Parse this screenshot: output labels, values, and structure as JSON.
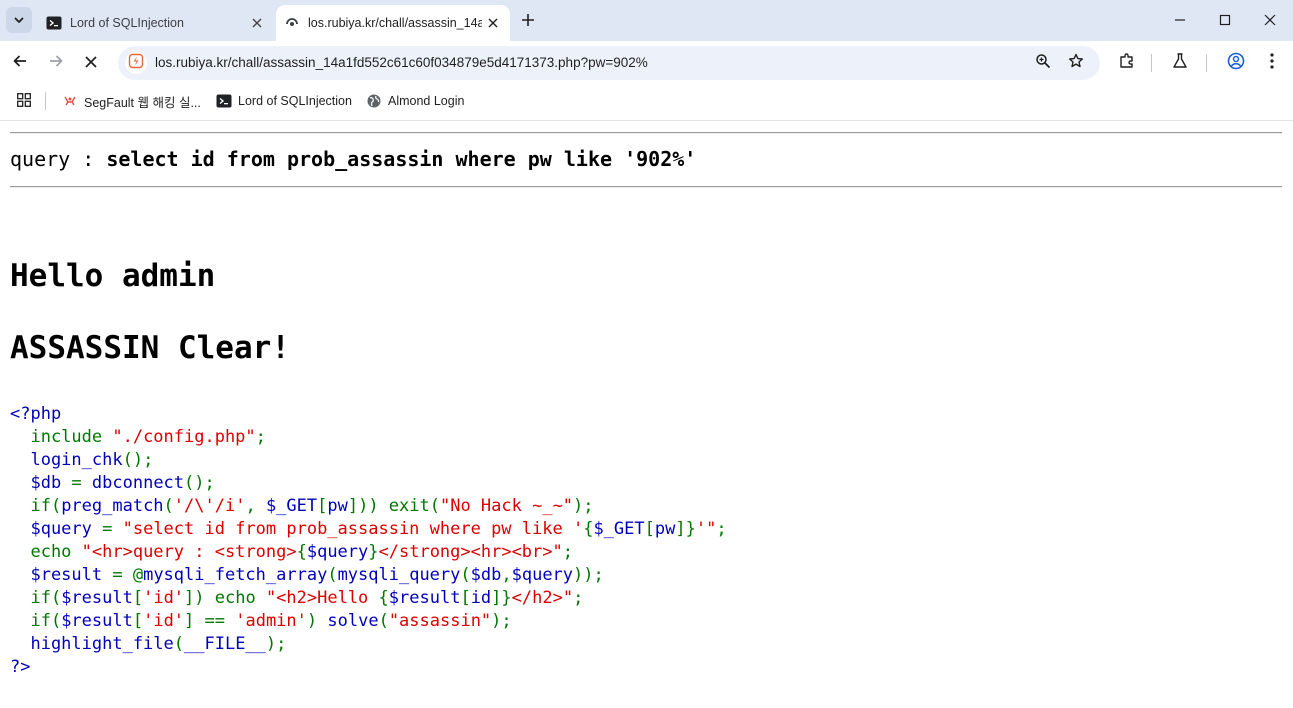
{
  "browser": {
    "tabs": [
      {
        "title": "Lord of SQLInjection",
        "active": false
      },
      {
        "title": "los.rubiya.kr/chall/assassin_14a",
        "active": true
      }
    ],
    "url": "los.rubiya.kr/chall/assassin_14a1fd552c61c60f034879e5d4171373.php?pw=902%",
    "bookmarks": [
      {
        "label": "SegFault 웹 해킹 실...",
        "icon": "segfault-icon"
      },
      {
        "label": "Lord of SQLInjection",
        "icon": "terminal-icon"
      },
      {
        "label": "Almond Login",
        "icon": "globe-icon"
      }
    ]
  },
  "page": {
    "query_prefix": "query : ",
    "query": "select id from prob_assassin where pw like '902%'",
    "hello": "Hello admin",
    "clear": "ASSASSIN Clear!",
    "code": [
      [
        {
          "t": "<?php",
          "c": "def"
        }
      ],
      [
        {
          "t": "  include ",
          "c": "kw"
        },
        {
          "t": "\"./config.php\"",
          "c": "str"
        },
        {
          "t": ";",
          "c": "kw"
        }
      ],
      [
        {
          "t": "  login_chk",
          "c": "def"
        },
        {
          "t": "();",
          "c": "kw"
        }
      ],
      [
        {
          "t": "  $db ",
          "c": "def"
        },
        {
          "t": "= ",
          "c": "kw"
        },
        {
          "t": "dbconnect",
          "c": "def"
        },
        {
          "t": "();",
          "c": "kw"
        }
      ],
      [
        {
          "t": "  if(",
          "c": "kw"
        },
        {
          "t": "preg_match",
          "c": "def"
        },
        {
          "t": "(",
          "c": "kw"
        },
        {
          "t": "'/\\'/i'",
          "c": "str"
        },
        {
          "t": ", ",
          "c": "kw"
        },
        {
          "t": "$_GET",
          "c": "def"
        },
        {
          "t": "[",
          "c": "kw"
        },
        {
          "t": "pw",
          "c": "def"
        },
        {
          "t": "])) exit(",
          "c": "kw"
        },
        {
          "t": "\"No Hack ~_~\"",
          "c": "str"
        },
        {
          "t": ");",
          "c": "kw"
        }
      ],
      [
        {
          "t": "  $query ",
          "c": "def"
        },
        {
          "t": "= ",
          "c": "kw"
        },
        {
          "t": "\"select id from prob_assassin where pw like '",
          "c": "str"
        },
        {
          "t": "{",
          "c": "kw"
        },
        {
          "t": "$_GET",
          "c": "def"
        },
        {
          "t": "[",
          "c": "kw"
        },
        {
          "t": "pw",
          "c": "def"
        },
        {
          "t": "]}",
          "c": "kw"
        },
        {
          "t": "'\"",
          "c": "str"
        },
        {
          "t": ";",
          "c": "kw"
        }
      ],
      [
        {
          "t": "  echo ",
          "c": "kw"
        },
        {
          "t": "\"<hr>query : <strong>",
          "c": "str"
        },
        {
          "t": "{",
          "c": "kw"
        },
        {
          "t": "$query",
          "c": "def"
        },
        {
          "t": "}",
          "c": "kw"
        },
        {
          "t": "</strong><hr><br>\"",
          "c": "str"
        },
        {
          "t": ";",
          "c": "kw"
        }
      ],
      [
        {
          "t": "  $result ",
          "c": "def"
        },
        {
          "t": "= @",
          "c": "kw"
        },
        {
          "t": "mysqli_fetch_array",
          "c": "def"
        },
        {
          "t": "(",
          "c": "kw"
        },
        {
          "t": "mysqli_query",
          "c": "def"
        },
        {
          "t": "(",
          "c": "kw"
        },
        {
          "t": "$db",
          "c": "def"
        },
        {
          "t": ",",
          "c": "kw"
        },
        {
          "t": "$query",
          "c": "def"
        },
        {
          "t": "));",
          "c": "kw"
        }
      ],
      [
        {
          "t": "  if(",
          "c": "kw"
        },
        {
          "t": "$result",
          "c": "def"
        },
        {
          "t": "[",
          "c": "kw"
        },
        {
          "t": "'id'",
          "c": "str"
        },
        {
          "t": "]) echo ",
          "c": "kw"
        },
        {
          "t": "\"<h2>Hello ",
          "c": "str"
        },
        {
          "t": "{",
          "c": "kw"
        },
        {
          "t": "$result",
          "c": "def"
        },
        {
          "t": "[",
          "c": "kw"
        },
        {
          "t": "id",
          "c": "def"
        },
        {
          "t": "]}",
          "c": "kw"
        },
        {
          "t": "</h2>\"",
          "c": "str"
        },
        {
          "t": ";",
          "c": "kw"
        }
      ],
      [
        {
          "t": "  if(",
          "c": "kw"
        },
        {
          "t": "$result",
          "c": "def"
        },
        {
          "t": "[",
          "c": "kw"
        },
        {
          "t": "'id'",
          "c": "str"
        },
        {
          "t": "] == ",
          "c": "kw"
        },
        {
          "t": "'admin'",
          "c": "str"
        },
        {
          "t": ") ",
          "c": "kw"
        },
        {
          "t": "solve",
          "c": "def"
        },
        {
          "t": "(",
          "c": "kw"
        },
        {
          "t": "\"assassin\"",
          "c": "str"
        },
        {
          "t": ");",
          "c": "kw"
        }
      ],
      [
        {
          "t": "  highlight_file",
          "c": "def"
        },
        {
          "t": "(",
          "c": "kw"
        },
        {
          "t": "__FILE__",
          "c": "def"
        },
        {
          "t": ");",
          "c": "kw"
        }
      ],
      [
        {
          "t": "?>",
          "c": "def"
        }
      ]
    ]
  }
}
